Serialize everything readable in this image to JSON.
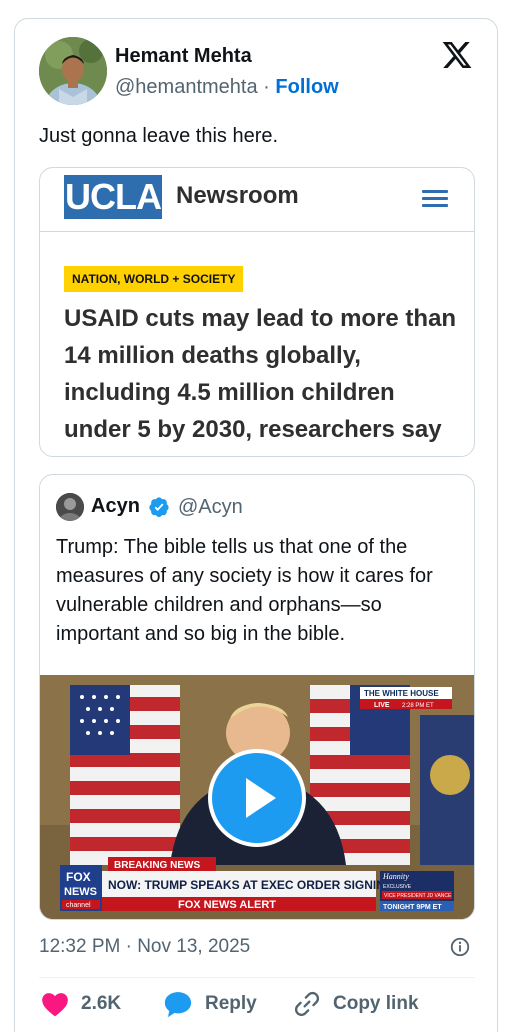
{
  "author": {
    "name": "Hemant Mehta",
    "handle": "@hemantmehta",
    "separator": "·",
    "follow_label": "Follow"
  },
  "tweet_text": "Just gonna leave this here.",
  "link_card": {
    "site_logo_text": "UCLA",
    "site_name": "Newsroom",
    "category": "NATION, WORLD + SOCIETY",
    "headline": "USAID cuts may lead to more than 14 million deaths globally, including 4.5 million children under 5 by 2030, researchers say"
  },
  "quoted_tweet": {
    "name": "Acyn",
    "handle": "@Acyn",
    "text": "Trump: The bible tells us that one of the measures of any society is how it cares for vulnerable children and orphans—so important and so big in the bible.",
    "video": {
      "bug_location": "THE WHITE HOUSE",
      "bug_live": "LIVE",
      "bug_time": "2:28 PM ET",
      "breaking_label": "BREAKING NEWS",
      "chyron": "NOW: TRUMP SPEAKS AT EXEC ORDER SIGNING",
      "alert": "FOX NEWS ALERT",
      "network_top": "FOX",
      "network_mid": "NEWS",
      "network_bottom": "channel",
      "promo_show": "Hannity",
      "promo_sub": "EXCLUSIVE",
      "promo_guest": "VICE PRESIDENT JD VANCE",
      "promo_time": "TONIGHT 9PM ET"
    }
  },
  "timestamp": "12:32 PM · Nov 13, 2025",
  "actions": {
    "like_count": "2.6K",
    "reply_label": "Reply",
    "copy_link_label": "Copy link"
  },
  "colors": {
    "accent": "#006fd6",
    "like": "#f91880",
    "ucla_blue": "#2e6dae",
    "ucla_gold": "#ffd100",
    "verified": "#1d9bf0"
  }
}
